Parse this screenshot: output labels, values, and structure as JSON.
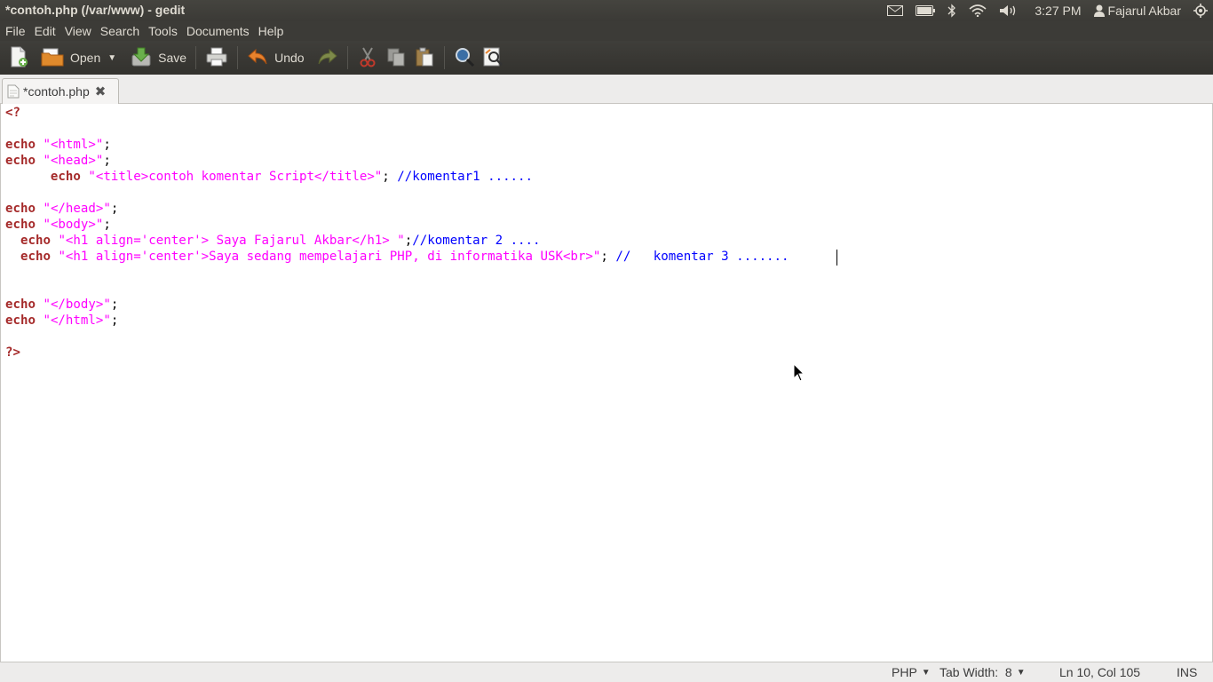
{
  "window": {
    "title": "*contoh.php (/var/www) - gedit"
  },
  "panel": {
    "time": "3:27 PM",
    "user": "Fajarul Akbar",
    "icons": [
      "mail-icon",
      "battery-icon",
      "bluetooth-icon",
      "wifi-icon",
      "volume-icon",
      "user-icon",
      "power-icon"
    ]
  },
  "menubar": {
    "items": [
      "File",
      "Edit",
      "View",
      "Search",
      "Tools",
      "Documents",
      "Help"
    ]
  },
  "toolbar": {
    "open_label": "Open",
    "save_label": "Save",
    "undo_label": "Undo"
  },
  "tab": {
    "title": "*contoh.php",
    "close": "✖"
  },
  "editor": {
    "lines": [
      [
        [
          "kw",
          "<?"
        ]
      ],
      [],
      [
        [
          "kw",
          "echo"
        ],
        [
          "plain",
          " "
        ],
        [
          "str",
          "\"<html>\""
        ],
        [
          "plain",
          ";"
        ]
      ],
      [
        [
          "kw",
          "echo"
        ],
        [
          "plain",
          " "
        ],
        [
          "str",
          "\"<head>\""
        ],
        [
          "plain",
          ";"
        ]
      ],
      [
        [
          "plain",
          "      "
        ],
        [
          "kw",
          "echo"
        ],
        [
          "plain",
          " "
        ],
        [
          "str",
          "\"<title>contoh komentar Script</title>\""
        ],
        [
          "plain",
          "; "
        ],
        [
          "cmt",
          "//komentar1 ......"
        ]
      ],
      [],
      [
        [
          "kw",
          "echo"
        ],
        [
          "plain",
          " "
        ],
        [
          "str",
          "\"</head>\""
        ],
        [
          "plain",
          ";"
        ]
      ],
      [
        [
          "kw",
          "echo"
        ],
        [
          "plain",
          " "
        ],
        [
          "str",
          "\"<body>\""
        ],
        [
          "plain",
          ";"
        ]
      ],
      [
        [
          "plain",
          "  "
        ],
        [
          "kw",
          "echo"
        ],
        [
          "plain",
          " "
        ],
        [
          "str",
          "\"<h1 align='center'> Saya Fajarul Akbar</h1> \""
        ],
        [
          "plain",
          ";"
        ],
        [
          "cmt",
          "//komentar 2 ...."
        ]
      ],
      [
        [
          "plain",
          "  "
        ],
        [
          "kw",
          "echo"
        ],
        [
          "plain",
          " "
        ],
        [
          "str",
          "\"<h1 align='center'>Saya sedang mempelajari PHP, di informatika USK<br>\""
        ],
        [
          "plain",
          "; "
        ],
        [
          "cmt",
          "//   komentar 3 ......."
        ]
      ],
      [],
      [],
      [
        [
          "kw",
          "echo"
        ],
        [
          "plain",
          " "
        ],
        [
          "str",
          "\"</body>\""
        ],
        [
          "plain",
          ";"
        ]
      ],
      [
        [
          "kw",
          "echo"
        ],
        [
          "plain",
          " "
        ],
        [
          "str",
          "\"</html>\""
        ],
        [
          "plain",
          ";"
        ]
      ],
      [],
      [
        [
          "kw",
          "?>"
        ]
      ]
    ]
  },
  "statusbar": {
    "language": "PHP",
    "tab_width": "Tab Width:  8",
    "position": "Ln 10, Col 105",
    "mode": "INS"
  }
}
